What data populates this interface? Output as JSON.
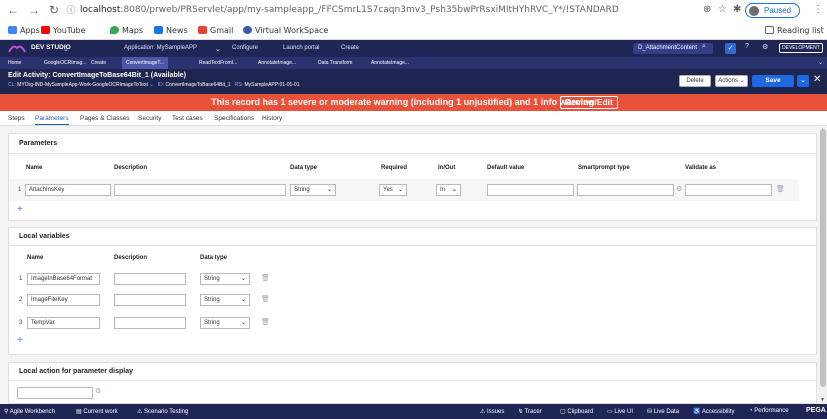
{
  "browser": {
    "url_host": "localhost",
    "url_path": ":8080/prweb/PRServlet/app/my-sampleapp_/FFCSmrL1S7caqn3mv3_Psh35bwPrRsxiMltHYhRVC_Y*/!STANDARD",
    "paused_label": "Paused",
    "bookmarks": [
      "Apps",
      "YouTube",
      "Maps",
      "News",
      "Gmail",
      "Virtual WorkSpace"
    ],
    "reading_list": "Reading list"
  },
  "pega_header": {
    "studio": "DEV STUDIO",
    "application": "Application: MySampleAPP",
    "configure": "Configure",
    "launch_portal": "Launch portal",
    "create": "Create",
    "search_value": "D_AttachmentContent",
    "environment": "DEVELOPMENT"
  },
  "tabs": [
    "Home",
    "GoogleOCRImag...",
    "Create",
    "ConvertImageT...",
    "ReadTextFromI...",
    "AnnotateImage...",
    "Data Transform",
    "AnnotateImage..."
  ],
  "rule": {
    "title": "Edit Activity: ConvertImageToBase64Bit_1 (Available)",
    "cl_label": "CL:",
    "cl_value": "MYOrg-IND-MySampleApp-Work-GoogleOCRImageToText",
    "id_label": "ID:",
    "id_value": "ConvertImageToBase64Bit_1",
    "rs_label": "RS:",
    "rs_value": "MySampleAPP:01-01-01",
    "delete_label": "Delete",
    "actions_label": "Actions",
    "save_label": "Save"
  },
  "warning": {
    "text": "This record has 1 severe or moderate warning (including 1 unjustified) and 1 info warning",
    "button": "Review/Edit"
  },
  "subtabs": [
    "Steps",
    "Parameters",
    "Pages & Classes",
    "Security",
    "Test cases",
    "Specifications",
    "History"
  ],
  "parameters": {
    "title": "Parameters",
    "headers": [
      "Name",
      "Description",
      "Data type",
      "Required",
      "In/Out",
      "Default value",
      "Smartprompt type",
      "Validate as"
    ],
    "rows": [
      {
        "num": "1",
        "name": "AttachInsKey",
        "description": "",
        "data_type": "String",
        "required": "Yes",
        "in_out": "In",
        "default_value": "",
        "smartprompt": "",
        "validate_as": ""
      }
    ]
  },
  "local_vars": {
    "title": "Local variables",
    "headers": [
      "Name",
      "Description",
      "Data type"
    ],
    "rows": [
      {
        "num": "1",
        "name": "ImageInBase64Format",
        "description": "",
        "data_type": "String"
      },
      {
        "num": "2",
        "name": "ImageFileKey",
        "description": "",
        "data_type": "String"
      },
      {
        "num": "3",
        "name": "TempVar",
        "description": "",
        "data_type": "String"
      }
    ]
  },
  "local_action": {
    "title": "Local action for parameter display",
    "value": ""
  },
  "statusbar": {
    "left": [
      "Agile Workbench",
      "Current work",
      "Scenario Testing"
    ],
    "right": [
      "Issues",
      "Tracer",
      "Clipboard",
      "Live UI",
      "Live Data",
      "Accessibility",
      "Performance"
    ],
    "brand": "PEGA"
  },
  "colors": {
    "header": "#1f2555",
    "warning": "#e8513a",
    "primary": "#1f69e0"
  }
}
